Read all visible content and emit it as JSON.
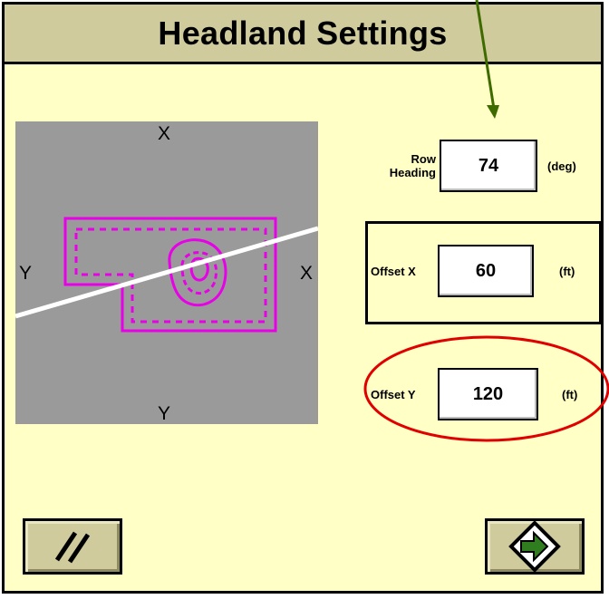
{
  "title": "Headland Settings",
  "preview": {
    "axis_top": "X",
    "axis_bottom": "Y",
    "axis_left": "Y",
    "axis_right": "X"
  },
  "fields": {
    "row_heading": {
      "label_line1": "Row",
      "label_line2": "Heading",
      "value": "74",
      "unit": "(deg)"
    },
    "offset_x": {
      "label": "Offset X",
      "value": "60",
      "unit": "(ft)"
    },
    "offset_y": {
      "label": "Offset Y",
      "value": "120",
      "unit": "(ft)"
    }
  },
  "colors": {
    "background": "#ffffc6",
    "titlebar": "#cfcb9d",
    "preview_bg": "#9a9a9a",
    "boundary": "#e800e8",
    "heading_line": "#ffffff",
    "arrow_annotation": "#3d6b00",
    "highlight_ellipse": "#e00000",
    "next_arrow": "#2f7d1f"
  },
  "buttons": {
    "left_icon": "double-slash-icon",
    "right_icon": "next-arrow-icon"
  }
}
